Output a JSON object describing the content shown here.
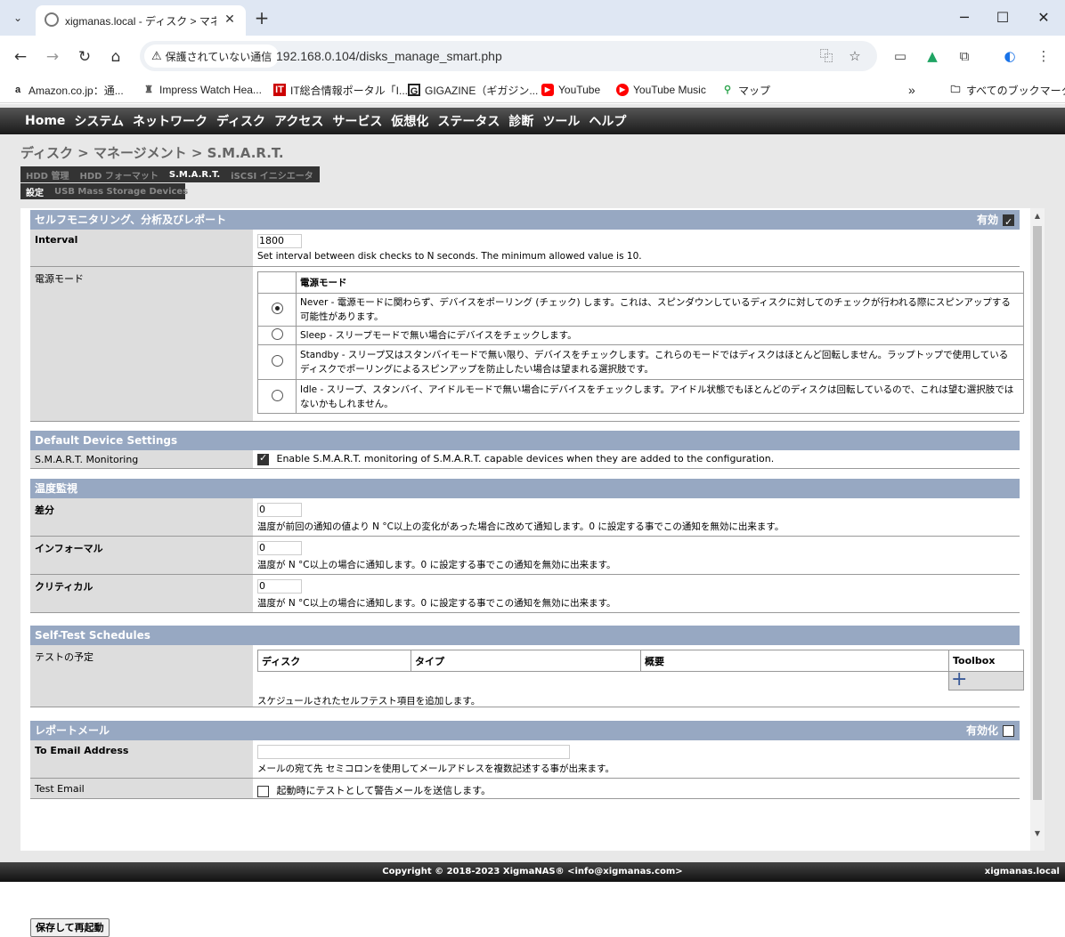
{
  "browser": {
    "tab_title": "xigmanas.local - ディスク > マネー",
    "security_chip": "保護されていない通信",
    "url": "192.168.0.104/disks_manage_smart.php",
    "bookmarks": [
      {
        "icon": "amazon-icon",
        "label": "Amazon.co.jp：通..."
      },
      {
        "icon": "impress-icon",
        "label": "Impress Watch Hea..."
      },
      {
        "icon": "itmedia-icon",
        "label": "IT総合情報ポータル「I..."
      },
      {
        "icon": "gigazine-icon",
        "label": "GIGAZINE（ギガジン..."
      },
      {
        "icon": "youtube-icon",
        "label": "YouTube"
      },
      {
        "icon": "youtube-music-icon",
        "label": "YouTube Music"
      },
      {
        "icon": "maps-icon",
        "label": "マップ"
      }
    ],
    "all_bookmarks": "すべてのブックマーク"
  },
  "menu": [
    "Home",
    "システム",
    "ネットワーク",
    "ディスク",
    "アクセス",
    "サービス",
    "仮想化",
    "ステータス",
    "診断",
    "ツール",
    "ヘルプ"
  ],
  "breadcrumb": "ディスク > マネージメント > S.M.A.R.T.",
  "tabs1": [
    "HDD 管理",
    "HDD フォーマット",
    "S.M.A.R.T.",
    "iSCSI イニシエータ"
  ],
  "tabs1_active": "S.M.A.R.T.",
  "tabs2": [
    "設定",
    "USB Mass Storage Devices"
  ],
  "tabs2_active": "設定",
  "sec_smart": {
    "title": "セルフモニタリング、分析及びレポート",
    "enable_label": "有効",
    "enabled": true
  },
  "interval": {
    "label": "Interval",
    "value": "1800",
    "hint": "Set interval between disk checks to N seconds. The minimum allowed value is 10."
  },
  "powermode": {
    "label": "電源モード",
    "header": "電源モード",
    "selected": 0,
    "options": [
      "Never - 電源モードに関わらず、デバイスをポーリング (チェック) します。これは、スピンダウンしているディスクに対してのチェックが行われる際にスピンアップする可能性があります。",
      "Sleep - スリープモードで無い場合にデバイスをチェックします。",
      "Standby - スリープ又はスタンバイモードで無い限り、デバイスをチェックします。これらのモードではディスクはほとんど回転しません。ラップトップで使用しているディスクでポーリングによるスピンアップを防止したい場合は望まれる選択肢です。",
      "Idle - スリープ、スタンバイ、アイドルモードで無い場合にデバイスをチェックします。アイドル状態でもほとんどのディスクは回転しているので、これは望む選択肢ではないかもしれません。"
    ]
  },
  "sec_default": {
    "title": "Default Device Settings",
    "monitor_label": "S.M.A.R.T. Monitoring",
    "monitor_checked": true,
    "monitor_text": "Enable S.M.A.R.T. monitoring of S.M.A.R.T. capable devices when they are added to the configuration."
  },
  "sec_temp": {
    "title": "温度監視",
    "diff": {
      "label": "差分",
      "value": "0",
      "hint": "温度が前回の通知の値より N °C以上の変化があった場合に改めて通知します。0 に設定する事でこの通知を無効に出来ます。"
    },
    "info": {
      "label": "インフォーマル",
      "value": "0",
      "hint": "温度が N °C以上の場合に通知します。0 に設定する事でこの通知を無効に出来ます。"
    },
    "crit": {
      "label": "クリティカル",
      "value": "0",
      "hint": "温度が N °C以上の場合に通知します。0 に設定する事でこの通知を無効に出来ます。"
    }
  },
  "sec_selftest": {
    "title": "Self-Test Schedules",
    "label": "テストの予定",
    "columns": [
      "ディスク",
      "タイプ",
      "概要",
      "Toolbox"
    ],
    "hint": "スケジュールされたセルフテスト項目を追加します。"
  },
  "sec_report": {
    "title": "レポートメール",
    "enable_label": "有効化",
    "enabled": false,
    "to_label": "To Email Address",
    "to_value": "",
    "to_hint": "メールの宛て先 セミコロンを使用してメールアドレスを複数記述する事が出来ます。",
    "test_label": "Test Email",
    "test_checked": false,
    "test_text": "起動時にテストとして警告メールを送信します。"
  },
  "save_button": "保存して再起動",
  "footer": {
    "copyright": "Copyright © 2018-2023 XigmaNAS® <info@xigmanas.com>",
    "host": "xigmanas.local"
  }
}
